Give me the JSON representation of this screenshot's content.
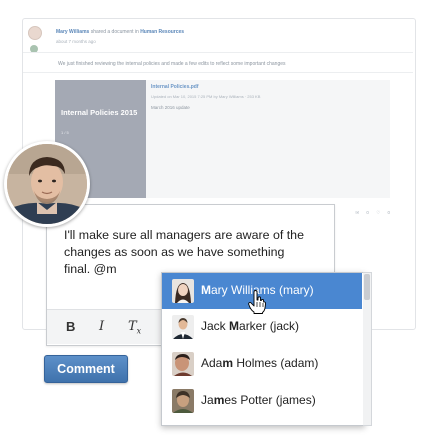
{
  "activity": {
    "author": "Mary Williams",
    "action": "shared a document in",
    "target": "Human Resources",
    "time": "about 7 months ago",
    "post_text": "We just finished reviewing the internal policies and made a few edits to reflect some important changes",
    "document": {
      "thumb_title": "Internal Policies 2015",
      "thumb_meta": "1 / 5",
      "file_name": "Internal Policies.pdf",
      "file_info": "Updated on Mar 10, 2015 7:25 PM by Mary Williams · 253 KB",
      "description": "March 2016 update"
    },
    "counts": {
      "comments": "0",
      "likes": "0"
    }
  },
  "editor": {
    "text": "I'll make sure all managers are aware of the changes as soon as we have something final.  @m",
    "bold_label": "B",
    "italic_label": "I",
    "clear_label": "T",
    "clear_sub": "x"
  },
  "comment_button": {
    "label": "Comment"
  },
  "mentions": {
    "items": [
      {
        "prefix": "",
        "match": "M",
        "rest": "ary Williams (mary)",
        "selected": true
      },
      {
        "prefix": "Jack ",
        "match": "M",
        "rest": "arker (jack)",
        "selected": false
      },
      {
        "prefix": "Ada",
        "match": "m",
        "rest": " Holmes (adam)",
        "selected": false
      },
      {
        "prefix": "Ja",
        "match": "m",
        "rest": "es Potter (james)",
        "selected": false
      }
    ]
  },
  "colors": {
    "accent": "#4a87d1",
    "button": "#3f72ac",
    "link": "#5a86b8"
  }
}
